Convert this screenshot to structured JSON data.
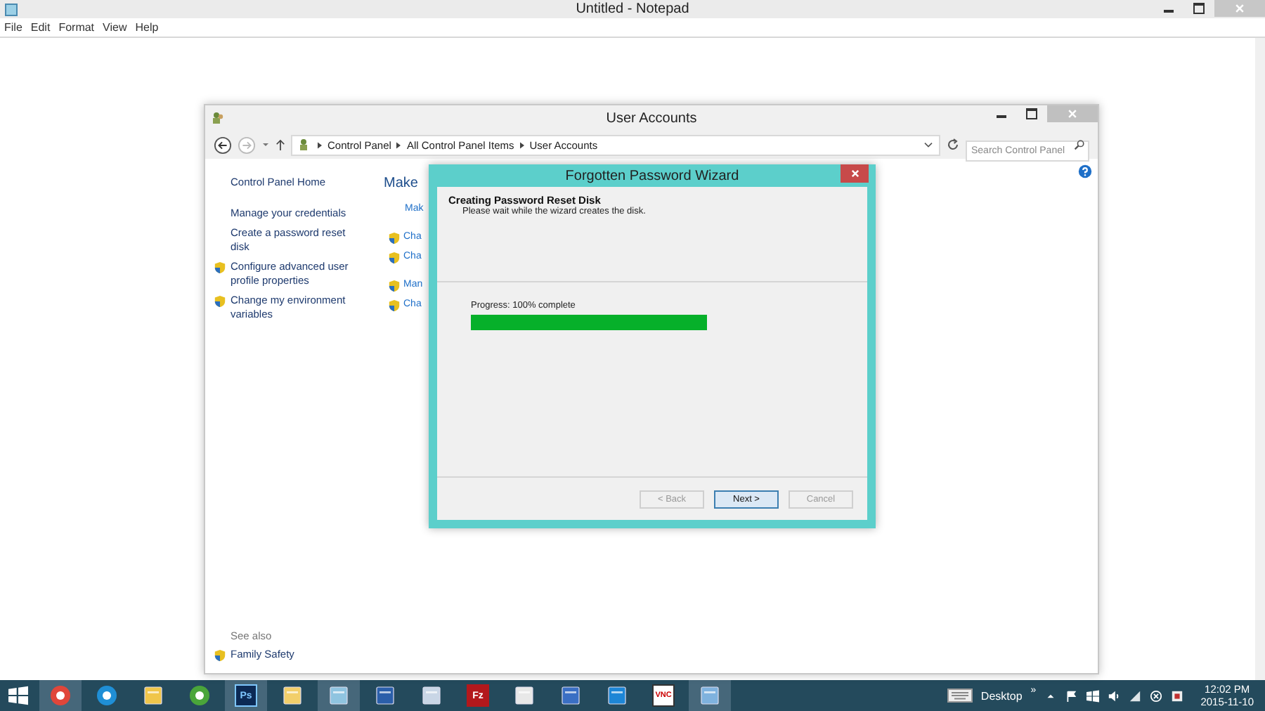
{
  "notepad": {
    "title": "Untitled - Notepad",
    "menu": [
      "File",
      "Edit",
      "Format",
      "View",
      "Help"
    ]
  },
  "user_accounts": {
    "title": "User Accounts",
    "breadcrumb": [
      "Control Panel",
      "All Control Panel Items",
      "User Accounts"
    ],
    "search": {
      "placeholder": "Search Control Panel"
    },
    "sidebar": [
      {
        "label": "Control Panel Home",
        "shield": false
      },
      {
        "label": "Manage your credentials",
        "shield": false
      },
      {
        "label": "Create a password reset disk",
        "shield": false
      },
      {
        "label": "Configure advanced user profile properties",
        "shield": true
      },
      {
        "label": "Change my environment variables",
        "shield": true
      }
    ],
    "see_also": "See also",
    "see_also_links": [
      {
        "label": "Family Safety",
        "shield": true
      }
    ],
    "heading": "Make",
    "link_groups": [
      [
        {
          "label": "Mak",
          "kind": "plain"
        }
      ],
      [
        {
          "label": "Cha",
          "kind": "shield"
        },
        {
          "label": "Cha",
          "kind": "shield"
        }
      ],
      [
        {
          "label": "Man",
          "kind": "shield"
        },
        {
          "label": "Cha",
          "kind": "shield"
        }
      ]
    ]
  },
  "wizard": {
    "title": "Forgotten Password Wizard",
    "heading": "Creating Password Reset Disk",
    "subheading": "Please wait while the wizard creates the disk.",
    "progress": {
      "label": "Progress: 100% complete",
      "level": 1.0
    },
    "buttons": [
      {
        "label": "< Back",
        "disabled": true,
        "default": false
      },
      {
        "label": "Next >",
        "disabled": false,
        "default": true
      },
      {
        "label": "Cancel",
        "disabled": true,
        "default": false
      }
    ]
  },
  "taskbar": {
    "apps": [
      {
        "kind": "chrome",
        "active": true
      },
      {
        "kind": "ie",
        "active": false
      },
      {
        "kind": "explorer",
        "active": false
      },
      {
        "kind": "dreamweaver",
        "active": false
      },
      {
        "kind": "photoshop",
        "label": "Ps",
        "active": true
      },
      {
        "kind": "folder",
        "active": false
      },
      {
        "kind": "notepad",
        "active": true
      },
      {
        "kind": "word",
        "active": false
      },
      {
        "kind": "document",
        "active": false
      },
      {
        "kind": "filezilla",
        "label": "Fz",
        "active": false
      },
      {
        "kind": "face",
        "active": false
      },
      {
        "kind": "computer",
        "active": false
      },
      {
        "kind": "teamviewer",
        "active": false
      },
      {
        "kind": "vnc",
        "label": "VNC",
        "active": false
      },
      {
        "kind": "control",
        "active": true
      }
    ],
    "desktop_label": "Desktop",
    "overflow": "»",
    "time": "12:02 PM",
    "date": "2015-11-10"
  }
}
